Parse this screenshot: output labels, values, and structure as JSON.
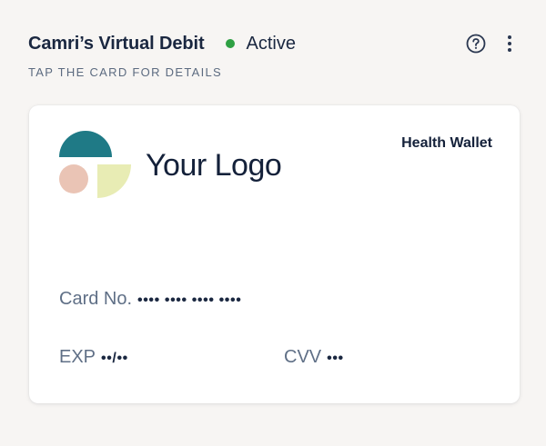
{
  "header": {
    "title": "Camri’s Virtual Debit",
    "status_label": "Active",
    "status_color": "#2ea043",
    "help_icon": "question-circle-icon",
    "more_icon": "vertical-ellipsis-icon"
  },
  "hint": "TAP THE CARD FOR DETAILS",
  "card": {
    "logo_text": "Your Logo",
    "wallet_name": "Health Wallet",
    "card_number_label": "Card No.",
    "card_number_masked": "•••• •••• •••• ••••",
    "exp_label": "EXP",
    "exp_masked": "••/••",
    "cvv_label": "CVV",
    "cvv_masked": "•••",
    "logo_colors": {
      "teal": "#1f7a86",
      "peach": "#eac4b5",
      "lime": "#e8ecb4"
    }
  }
}
